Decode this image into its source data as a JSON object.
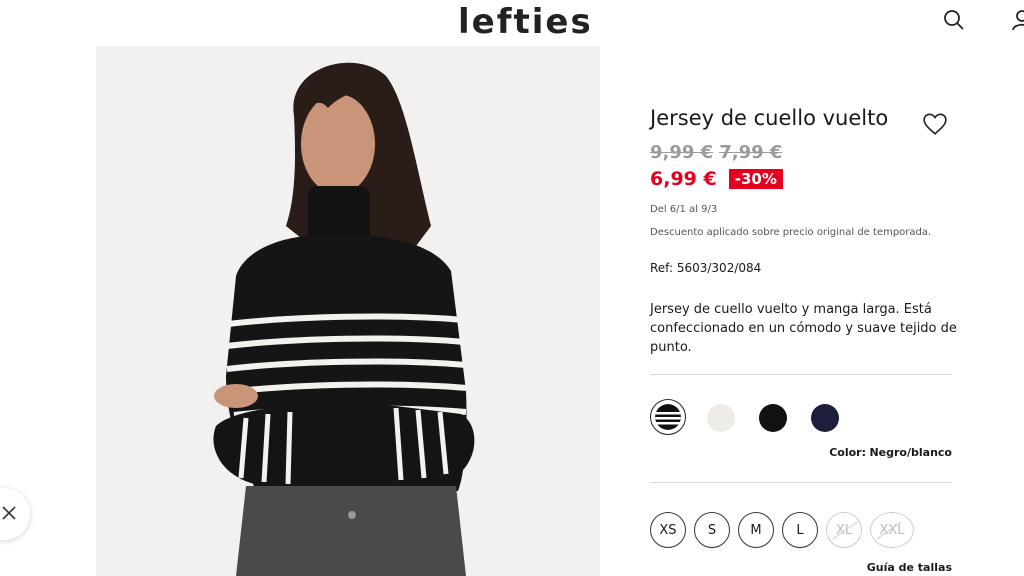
{
  "header": {
    "logo": "lefties",
    "icons": [
      "search-icon",
      "user-icon"
    ]
  },
  "product": {
    "title": "Jersey de cuello vuelto",
    "old_price_1": "9,99 €",
    "old_price_2": "7,99 €",
    "price": "6,99 €",
    "discount": "-30%",
    "dates": "Del 6/1 al 9/3",
    "discount_note": "Descuento aplicado sobre precio original de temporada.",
    "ref": "Ref: 5603/302/084",
    "description": "Jersey de cuello vuelto y manga larga. Está confeccionado en un cómodo y suave tejido de punto.",
    "color_label": "Color:",
    "color_value": "Negro/blanco",
    "swatches": [
      {
        "name": "negro-blanco",
        "selected": true
      },
      {
        "name": "crudo",
        "color": "#efebe6"
      },
      {
        "name": "negro",
        "color": "#111111"
      },
      {
        "name": "marino",
        "color": "#1b1f3b"
      }
    ],
    "sizes": [
      {
        "label": "XS",
        "available": true
      },
      {
        "label": "S",
        "available": true
      },
      {
        "label": "M",
        "available": true
      },
      {
        "label": "L",
        "available": true
      },
      {
        "label": "XL",
        "available": false
      },
      {
        "label": "XXL",
        "available": false
      }
    ],
    "size_guide": "Guía de tallas"
  },
  "colors": {
    "sale_red": "#e4001f",
    "old_price_gray": "#9a9a9a"
  }
}
